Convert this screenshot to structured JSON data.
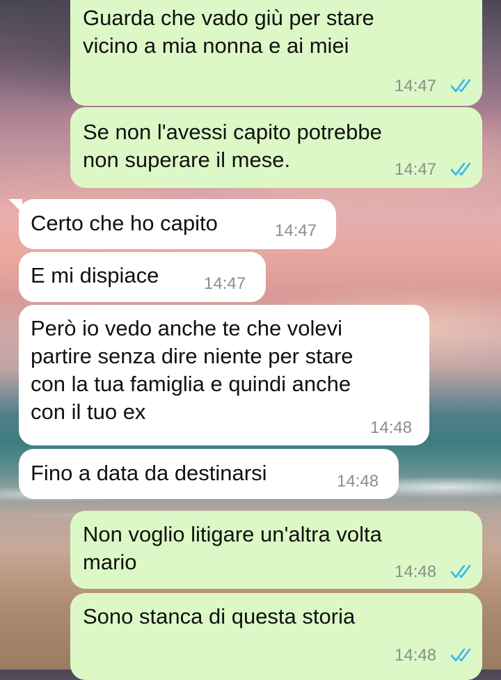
{
  "colors": {
    "outgoing_bubble": "#dcf8c6",
    "incoming_bubble": "#ffffff",
    "read_ticks": "#34b7f1",
    "time_text": "#8a8f8a"
  },
  "messages": [
    {
      "direction": "outgoing",
      "text": "Guarda che vado giù per stare\nvicino a mia nonna e ai miei",
      "time": "14:47",
      "status": "read",
      "status_icon": "double-check-icon"
    },
    {
      "direction": "outgoing",
      "text": "Se non l'avessi capito potrebbe\nnon superare il mese.",
      "time": "14:47",
      "status": "read",
      "status_icon": "double-check-icon"
    },
    {
      "direction": "incoming",
      "text": "Certo che ho capito",
      "time": "14:47"
    },
    {
      "direction": "incoming",
      "text": "E mi dispiace",
      "time": "14:47"
    },
    {
      "direction": "incoming",
      "text": "Però io vedo anche te che volevi\npartire senza dire niente per stare\ncon la tua famiglia e quindi anche\ncon il tuo ex",
      "time": "14:48"
    },
    {
      "direction": "incoming",
      "text": "Fino a data da destinarsi",
      "time": "14:48"
    },
    {
      "direction": "outgoing",
      "text": "Non voglio litigare un'altra volta\nmario",
      "time": "14:48",
      "status": "read",
      "status_icon": "double-check-icon"
    },
    {
      "direction": "outgoing",
      "text": "Sono stanca di questa storia",
      "time": "14:48",
      "status": "read",
      "status_icon": "double-check-icon"
    }
  ]
}
